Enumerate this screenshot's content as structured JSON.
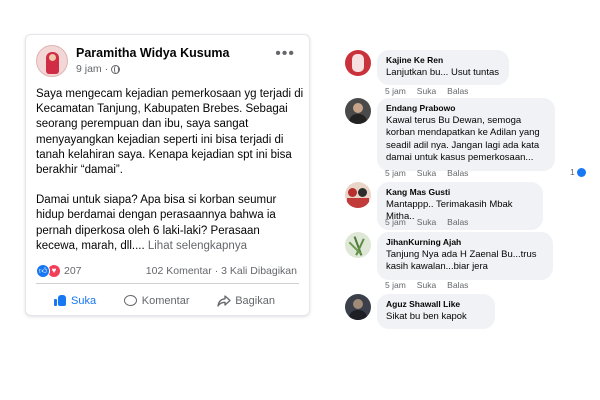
{
  "post": {
    "author": "Paramitha Widya Kusuma",
    "time": "9 jam",
    "paragraphs": [
      "Saya mengecam kejadian pemerkosaan yg terjadi di Kecamatan Tanjung, Kabupaten Brebes. Sebagai seorang perempuan dan ibu, saya sangat menyayangkan kejadian seperti ini bisa terjadi di tanah kelahiran saya. Kenapa kejadian spt ini bisa berakhir “damai”.",
      "Damai untuk siapa? Apa bisa si korban seumur hidup berdamai dengan perasaannya bahwa ia pernah diperkosa oleh 6 laki-laki? Perasaan kecewa, marah, dll.... "
    ],
    "see_more": "Lihat selengkapnya",
    "reaction_count": "207",
    "comment_count": "102 Komentar",
    "share_count": "3 Kali Dibagikan",
    "separator": "·",
    "actions": {
      "like": "Suka",
      "comment": "Komentar",
      "share": "Bagikan"
    }
  },
  "comments": [
    {
      "name": "Kajine Ke Ren",
      "text": "Lanjutkan bu... Usut tuntas",
      "time": "5 jam",
      "like": "Suka",
      "reply": "Balas",
      "likes": ""
    },
    {
      "name": "Endang Prabowo",
      "text": "Kawal terus Bu Dewan, semoga korban mendapatkan ke Adilan yang seadil adil nya. Jangan lagi ada kata damai untuk kasus pemerkosaan...",
      "time": "5 jam",
      "like": "Suka",
      "reply": "Balas",
      "likes": "1"
    },
    {
      "name": "Kang Mas Gusti",
      "text": "Mantappp.. Terimakasih Mbak Mitha..",
      "time": "5 jam",
      "like": "Suka",
      "reply": "Balas",
      "likes": ""
    },
    {
      "name": "JihanKurning Ajah",
      "text": "Tanjung Nya ada H Zaenal Bu...trus kasih kawalan...biar jera",
      "time": "5 jam",
      "like": "Suka",
      "reply": "Balas",
      "likes": ""
    },
    {
      "name": "Aguz Shawall Like",
      "text": "Sikat bu ben kapok",
      "time": "",
      "like": "",
      "reply": "",
      "likes": ""
    }
  ],
  "colors": {
    "brand": "#1877f2",
    "love": "#f33e58",
    "muted": "#65676b",
    "bubble": "#f0f2f5"
  },
  "icons": [
    "globe-icon",
    "more-options-icon",
    "like-reaction-icon",
    "love-reaction-icon",
    "like-icon",
    "comment-icon",
    "share-icon"
  ]
}
